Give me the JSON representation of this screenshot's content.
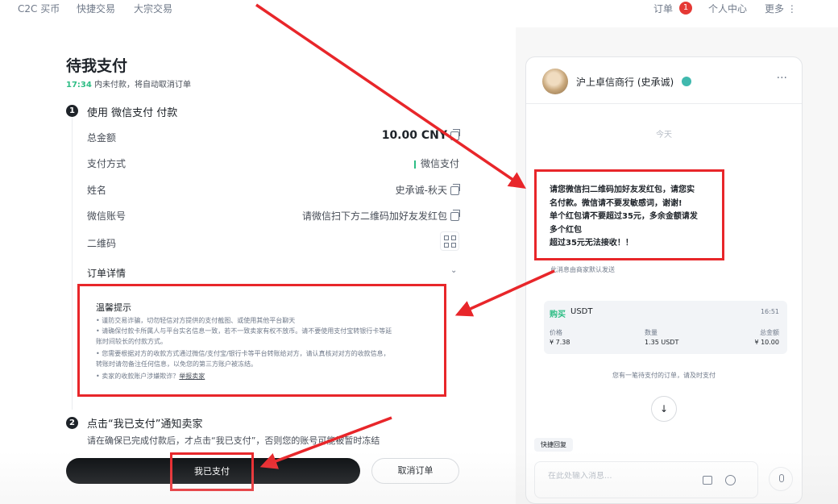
{
  "nav": {
    "c2c": "C2C 买币",
    "quick": "快捷交易",
    "block": "大宗交易",
    "orders": "订单",
    "order_count": "1",
    "account": "个人中心",
    "more": "更多 ⋮"
  },
  "payment": {
    "title": "待我支付",
    "countdown_time": "17:34",
    "countdown_text": " 内未付款，将自动取消订单",
    "step1_num": "1",
    "step1_title": "使用 微信支付 付款",
    "rows": {
      "amount_label": "总金额",
      "amount_value": "10.00 CNY",
      "method_label": "支付方式",
      "method_value": "微信支付",
      "name_label": "姓名",
      "name_value": "史承诚-秋天",
      "account_label": "微信账号",
      "account_value": "请微信扫下方二维码加好友发红包",
      "qr_label": "二维码"
    },
    "order_detail": "订单详情",
    "notice": {
      "title": "温馨提示",
      "lines": [
        "• 谨防交易诈骗，切勿轻信对方提供的支付截图、或使用其他平台聊天",
        "• 请确保付款卡所属人与平台实名信息一致，若不一致卖家有权不放币。请不要使用支付宝转银行卡等延",
        "  账时间较长的付款方式。",
        "• 您需要根据对方的收款方式通过微信/支付宝/银行卡等平台转账给对方，请认真核对对方的收款信息，",
        "  转账时请勿备注任何信息，以免您的第三方账户被冻结。",
        "• 卖家的收款账户涉嫌欺诈？"
      ],
      "report_link": "举报卖家"
    },
    "step2_num": "2",
    "step2_title": "点击“我已支付”通知卖家",
    "step2_sub": "请在确保已完成付款后，才点击“我已支付”，否则您的账号可能被暂时冻结",
    "paid_button": "我已支付",
    "cancel_button": "取消订单"
  },
  "chat": {
    "merchant_name": "沪上卓信商行 (史承诚)",
    "more": "···",
    "today": "今天",
    "message_lines": [
      "请您微信扫二维码加好友发红包，请您实",
      "名付款。微信请不要发敏感词，谢谢!",
      "单个红包请不要超过35元，多余金额请发",
      "多个红包",
      "超过35元无法接收！！"
    ],
    "system_note": "此消息由商家默认发送",
    "order_card": {
      "side": "购买",
      "coin": "USDT",
      "time": "16:51",
      "price_label": "价格",
      "price": "¥ 7.38",
      "qty_label": "数量",
      "qty": "1.35 USDT",
      "total_label": "总金额",
      "total": "¥ 10.00"
    },
    "pending_note": "您有一笔待支付的订单，请及时支付",
    "quick_reply": "快捷回复",
    "input_placeholder": "在此处输入消息..."
  },
  "colors": {
    "annotation_red": "#e8262a",
    "buy_green": "#2ebd85",
    "button_black": "#0b0e11"
  }
}
